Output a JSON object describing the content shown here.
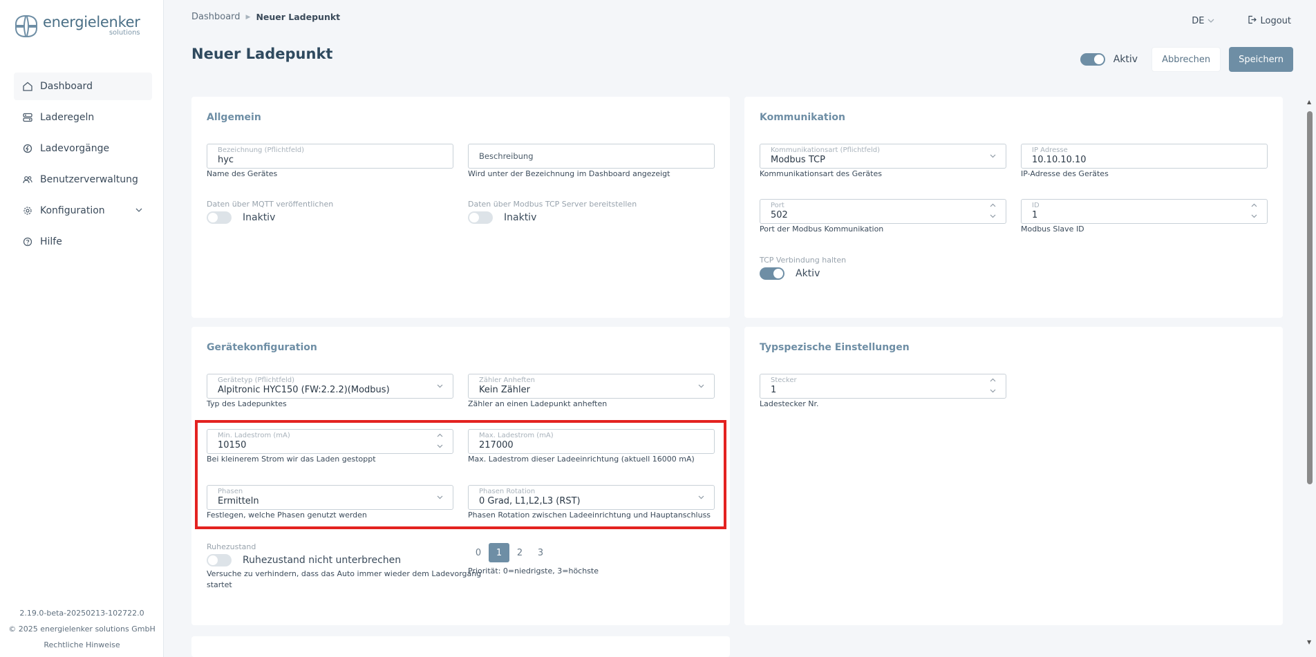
{
  "brand": {
    "name": "energielenker",
    "sub": "solutions"
  },
  "sidebar": {
    "items": [
      {
        "label": "Dashboard",
        "icon": "home-icon"
      },
      {
        "label": "Laderegeln",
        "icon": "rules-icon"
      },
      {
        "label": "Ladevorgänge",
        "icon": "charging-icon"
      },
      {
        "label": "Benutzerverwaltung",
        "icon": "users-icon"
      },
      {
        "label": "Konfiguration",
        "icon": "gear-icon"
      },
      {
        "label": "Hilfe",
        "icon": "help-icon"
      }
    ],
    "footer": {
      "version": "2.19.0-beta-20250213-102722.0",
      "copyright": "© 2025 energielenker solutions GmbH",
      "legal": "Rechtliche Hinweise"
    }
  },
  "breadcrumb": {
    "root": "Dashboard",
    "current": "Neuer Ladepunkt"
  },
  "topbar": {
    "lang": "DE",
    "logout": "Logout"
  },
  "page": {
    "title": "Neuer Ladepunkt",
    "active_label": "Aktiv",
    "cancel": "Abbrechen",
    "save": "Speichern"
  },
  "allgemein": {
    "title": "Allgemein",
    "name_label": "Bezeichnung (Pflichtfeld)",
    "name_value": "hyc",
    "name_hint": "Name des Gerätes",
    "desc_placeholder": "Beschreibung",
    "desc_hint": "Wird unter der Bezeichnung im Dashboard angezeigt",
    "mqtt_label": "Daten über MQTT veröffentlichen",
    "mqtt_state": "Inaktiv",
    "modbus_label": "Daten über Modbus TCP Server bereitstellen",
    "modbus_state": "Inaktiv"
  },
  "kommunikation": {
    "title": "Kommunikation",
    "type_label": "Kommunikationsart (Pflichtfeld)",
    "type_value": "Modbus TCP",
    "type_hint": "Kommunikationsart des Gerätes",
    "ip_label": "IP Adresse",
    "ip_value": "10.10.10.10",
    "ip_hint": "IP-Adresse des Gerätes",
    "port_label": "Port",
    "port_value": "502",
    "port_hint": "Port der Modbus Kommunikation",
    "id_label": "ID",
    "id_value": "1",
    "id_hint": "Modbus Slave ID",
    "tcp_label": "TCP Verbindung halten",
    "tcp_state": "Aktiv"
  },
  "geraet": {
    "title": "Gerätekonfiguration",
    "type_label": "Gerätetyp (Pflichtfeld)",
    "type_value": "Alpitronic HYC150 (FW:2.2.2)(Modbus)",
    "type_hint": "Typ des Ladepunktes",
    "meter_label": "Zähler Anheften",
    "meter_value": "Kein Zähler",
    "meter_hint": "Zähler an einen Ladepunkt anheften",
    "min_label": "Min. Ladestrom (mA)",
    "min_value": "10150",
    "min_hint": "Bei kleinerem Strom wir das Laden gestoppt",
    "max_label": "Max. Ladestrom (mA)",
    "max_value": "217000",
    "max_hint": "Max. Ladestrom dieser Ladeeinrichtung (aktuell 16000 mA)",
    "phases_label": "Phasen",
    "phases_value": "Ermitteln",
    "phases_hint": "Festlegen, welche Phasen genutzt werden",
    "rotation_label": "Phasen Rotation",
    "rotation_value": "0 Grad, L1,L2,L3 (RST)",
    "rotation_hint": "Phasen Rotation zwischen Ladeeinrichtung und Hauptanschluss",
    "rest_label": "Ruhezustand",
    "rest_state": "Ruhezustand nicht unterbrechen",
    "rest_hint_1": "Versuche zu verhindern, dass das Auto immer wieder dem Ladevorgang",
    "rest_hint_2": "startet",
    "priority_options": [
      "0",
      "1",
      "2",
      "3"
    ],
    "priority_hint": "Priorität: 0=niedrigste, 3=höchste"
  },
  "typ": {
    "title": "Typspezische Einstellungen",
    "plug_label": "Stecker",
    "plug_value": "1",
    "plug_hint": "Ladestecker Nr."
  }
}
